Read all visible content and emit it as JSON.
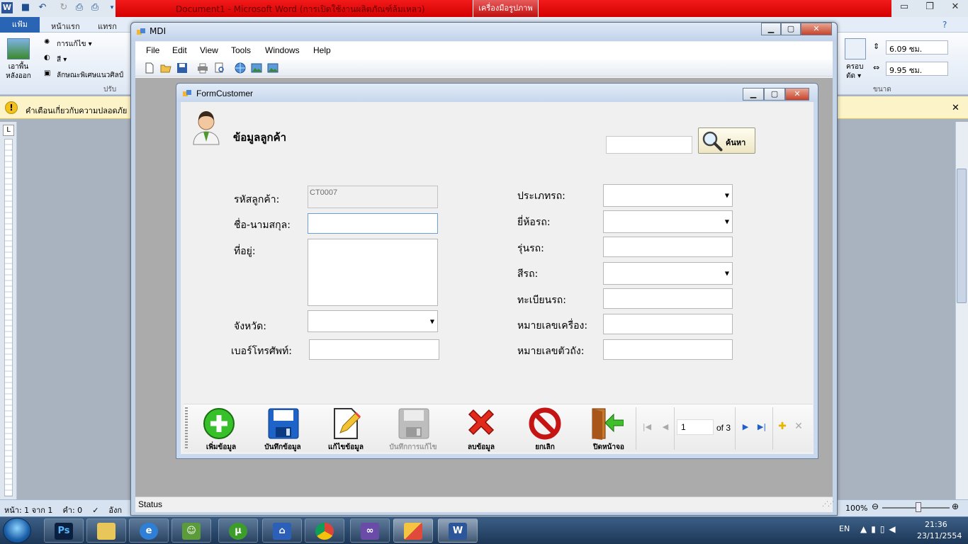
{
  "word": {
    "title": "Document1  -  Microsoft Word (การเปิดใช้งานผลิตภัณฑ์ล้มเหลว)",
    "contextual_tab": "เครื่องมือรูปภาพ",
    "tabs": [
      "แฟ้ม",
      "หน้าแรก",
      "แทรก"
    ],
    "ribbon": {
      "remove_background": "เอาพื้นหลังออก",
      "corrections": "การแก้ไข ▾",
      "color": "สี ▾",
      "artistic_effects": "ลักษณะพิเศษแนวศิลป์",
      "adjust_group": "ปรับ",
      "crop": "ครอบตัด ▾",
      "height": "6.09 ซม.",
      "width": "9.95 ซม.",
      "size_group": "ขนาด"
    },
    "security_warning": "คำเตือนเกี่ยวกับความปลอดภัย",
    "status": {
      "page": "หน้า: 1 จาก 1",
      "words": "คำ: 0",
      "language": "อังก",
      "zoom": "100%"
    }
  },
  "mdi": {
    "title": "MDI",
    "menu": [
      "File",
      "Edit",
      "View",
      "Tools",
      "Windows",
      "Help"
    ],
    "status": "Status"
  },
  "form": {
    "title": "FormCustomer",
    "heading": "ข้อมูลลูกค้า",
    "search": {
      "value": "",
      "button": "ค้นหา"
    },
    "left_fields": {
      "customer_id": {
        "label": "รหัสลูกค้า:",
        "value": "CT0007"
      },
      "full_name": {
        "label": "ชื่อ-นามสกุล:",
        "value": ""
      },
      "address": {
        "label": "ที่อยู่:",
        "value": ""
      },
      "province": {
        "label": "จังหวัด:",
        "value": ""
      },
      "phone": {
        "label": "เบอร์โทรศัพท์:",
        "value": ""
      }
    },
    "right_fields": {
      "car_type": {
        "label": "ประเภทรถ:",
        "value": ""
      },
      "car_brand": {
        "label": "ยี่ห้อรถ:",
        "value": ""
      },
      "car_model": {
        "label": "รุ่นรถ:",
        "value": ""
      },
      "car_color": {
        "label": "สีรถ:",
        "value": ""
      },
      "registration": {
        "label": "ทะเบียนรถ:",
        "value": ""
      },
      "engine_no": {
        "label": "หมายเลขเครื่อง:",
        "value": ""
      },
      "chassis_no": {
        "label": "หมายเลขตัวถัง:",
        "value": ""
      }
    },
    "actions": {
      "add": "เพิ่มข้อมูล",
      "save": "บันทึกข้อมูล",
      "edit": "แก้ไขข้อมูล",
      "save_edit": "บันทึกการแก้ไข",
      "delete": "ลบข้อมูล",
      "cancel": "ยกเลิก",
      "close": "ปิดหน้าจอ"
    },
    "navigator": {
      "position": "1",
      "count": "of 3"
    }
  },
  "taskbar": {
    "language": "EN",
    "time": "21:36",
    "date": "23/11/2554"
  },
  "colors": {
    "word_red": "#e00a0a",
    "file_tab": "#2a64b5",
    "mdi_gray": "#ababab"
  }
}
